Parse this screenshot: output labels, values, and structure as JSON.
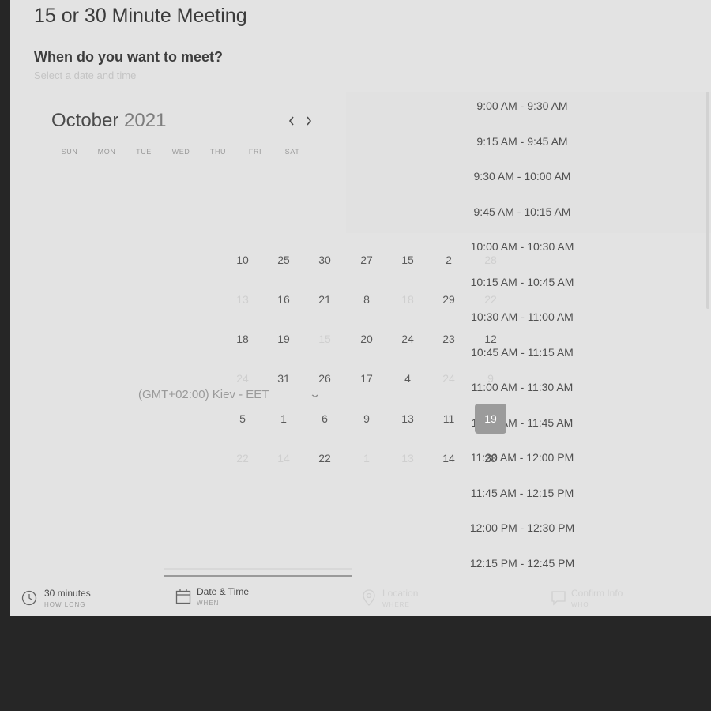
{
  "header": {
    "title": "15 or 30 Minute Meeting",
    "question": "When do you want to meet?",
    "subtitle": "Select a date and time"
  },
  "calendar": {
    "month": "October",
    "year": "2021",
    "prev_icon": "chevron-left-icon",
    "next_icon": "chevron-right-icon",
    "weekdays": [
      "SUN",
      "MON",
      "TUE",
      "WED",
      "THU",
      "FRI",
      "SAT"
    ],
    "grid": [
      [
        "10",
        "25",
        "30",
        "27",
        "15",
        "2",
        "28"
      ],
      [
        "13",
        "16",
        "21",
        "8",
        "18",
        "29",
        "22"
      ],
      [
        "18",
        "19",
        "15",
        "20",
        "24",
        "23",
        "12"
      ],
      [
        "24",
        "31",
        "26",
        "17",
        "4",
        "24",
        "9"
      ],
      [
        "5",
        "1",
        "6",
        "9",
        "13",
        "11",
        "19"
      ],
      [
        "22",
        "14",
        "22",
        "1",
        "13",
        "14",
        "28"
      ]
    ],
    "selected": "19"
  },
  "timezone": {
    "label": "(GMT+02:00) Kiev - EET",
    "chevron_icon": "chevron-down-icon"
  },
  "time_slots": [
    "9:00 AM - 9:30 AM",
    "9:15 AM - 9:45 AM",
    "9:30 AM - 10:00 AM",
    "9:45 AM - 10:15 AM",
    "10:00 AM - 10:30 AM",
    "10:15 AM - 10:45 AM",
    "10:30 AM - 11:00 AM",
    "10:45 AM - 11:15 AM",
    "11:00 AM - 11:30 AM",
    "11:15 AM - 11:45 AM",
    "11:30 AM - 12:00 PM",
    "11:45 AM - 12:15 PM",
    "12:00 PM - 12:30 PM",
    "12:15 PM - 12:45 PM"
  ],
  "steps": [
    {
      "label": "30 minutes",
      "sub": "HOW LONG",
      "icon": "clock-icon"
    },
    {
      "label": "Date & Time",
      "sub": "WHEN",
      "icon": "calendar-icon"
    },
    {
      "label": "Location",
      "sub": "WHERE",
      "icon": "location-pin-icon"
    },
    {
      "label": "Confirm Info",
      "sub": "WHO",
      "icon": "comment-icon"
    }
  ],
  "colors": {
    "panel_bg": "#e3e3e3",
    "page_bg": "#262626",
    "selected_day": "#9b9b9b",
    "active_step": "#9a9a9a"
  }
}
